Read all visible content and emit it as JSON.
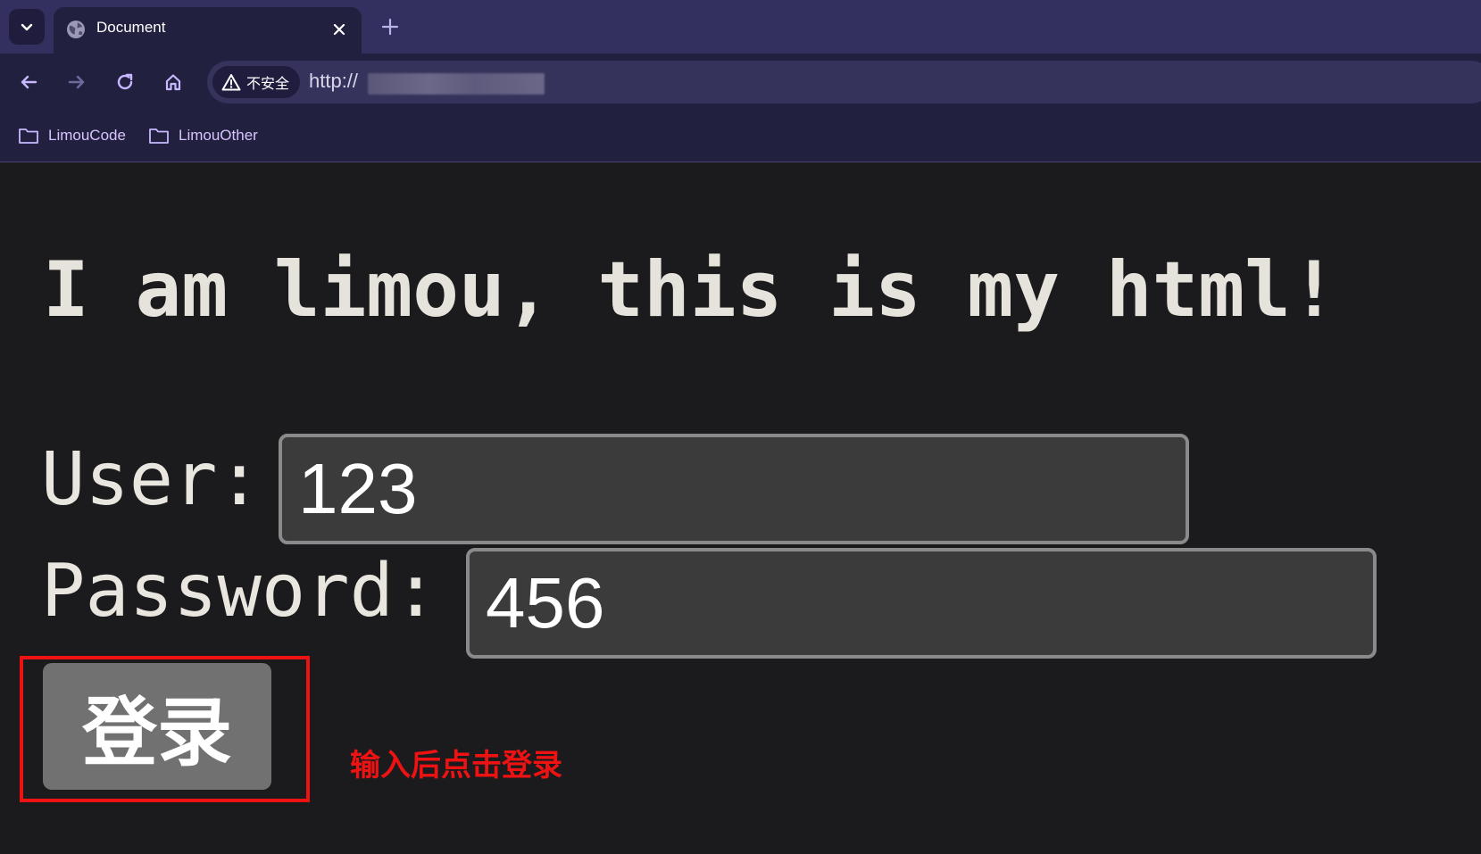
{
  "browser": {
    "tab": {
      "title": "Document"
    },
    "omnibox": {
      "security_label": "不安全",
      "url": "http://"
    },
    "bookmarks": [
      {
        "label": "LimouCode"
      },
      {
        "label": "LimouOther"
      }
    ]
  },
  "page": {
    "heading": "I am limou, this is my html!",
    "user_label": "User:",
    "user_value": "123",
    "password_label": "Password:",
    "password_value": "456",
    "login_label": "登录"
  },
  "annotation": {
    "text": "输入后点击登录",
    "color": "#ee1212"
  },
  "icons": [
    "chevron-down-icon",
    "globe-icon",
    "close-icon",
    "plus-icon",
    "back-arrow-icon",
    "forward-arrow-icon",
    "reload-icon",
    "home-icon",
    "warning-icon",
    "folder-icon"
  ],
  "colors": {
    "tabstrip": "#332f5e",
    "toolbar": "#22203f",
    "page_background": "#1b1b1d",
    "bookmark_text": "#d7c4ff",
    "highlight": "#ee1212"
  }
}
